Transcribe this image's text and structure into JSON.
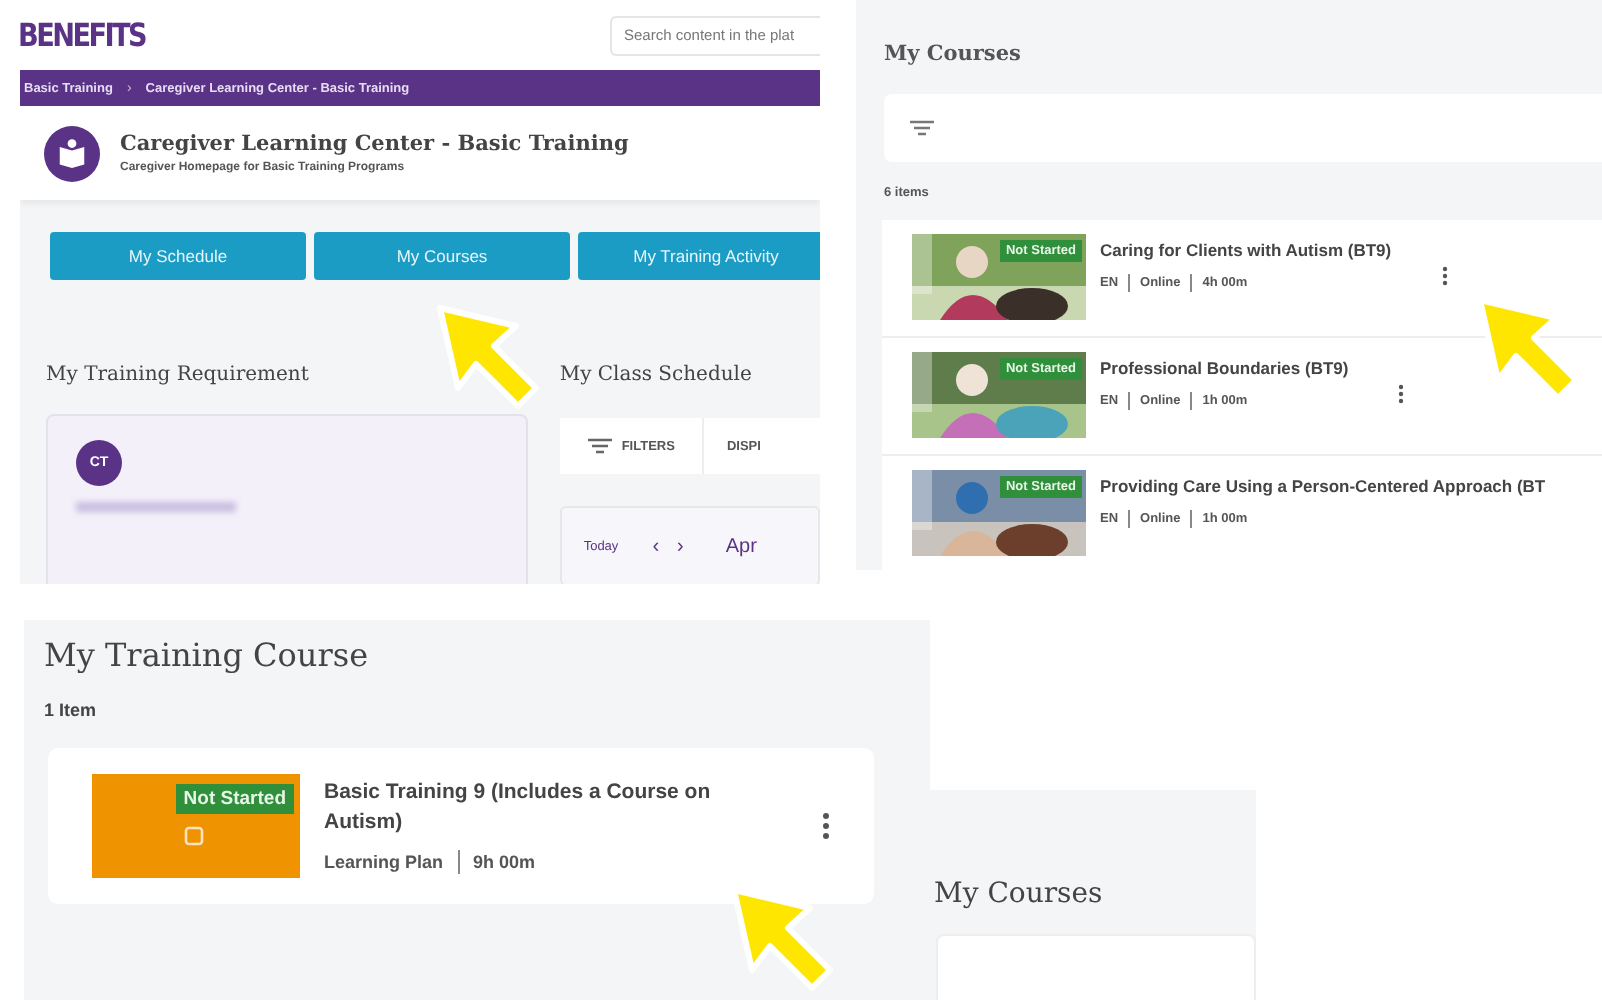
{
  "portal": {
    "logo": "BENEFITS",
    "search": {
      "placeholder": "Search content in the plat"
    },
    "breadcrumb": [
      "Basic Training",
      "Caregiver Learning Center - Basic Training"
    ],
    "separator": "›",
    "title": "Caregiver Learning Center - Basic Training",
    "subtitle": "Caregiver Homepage for Basic Training Programs",
    "nav_buttons": [
      "My Schedule",
      "My Courses",
      "My Training Activity"
    ],
    "requirement": {
      "heading": "My Training Requirement",
      "avatar": "CT"
    },
    "schedule": {
      "heading": "My Class Schedule",
      "filters": "FILTERS",
      "display": "DISPI",
      "today": "Today",
      "prev": "‹",
      "next": "›",
      "month": "Apr"
    }
  },
  "courses_panel": {
    "heading": "My Courses",
    "count": "6 items",
    "courses": [
      {
        "title": "Caring for Clients with Autism (BT9)",
        "status": "Not Started",
        "meta": [
          "EN",
          "Online",
          "4h 00m"
        ]
      },
      {
        "title": "Professional Boundaries (BT9)",
        "status": "Not Started",
        "meta": [
          "EN",
          "Online",
          "1h 00m"
        ]
      },
      {
        "title": "Providing Care Using a Person-Centered Approach (BT",
        "status": "Not Started",
        "meta": [
          "EN",
          "Online",
          "1h 00m"
        ]
      }
    ]
  },
  "training_panel": {
    "heading": "My Training Course",
    "count": "1 Item",
    "course": {
      "title": "Basic Training 9 (Includes a Course on Autism)",
      "status": "Not Started",
      "meta": [
        "Learning Plan",
        "9h 00m"
      ]
    }
  },
  "courses_panel_2": {
    "heading": "My Courses"
  }
}
